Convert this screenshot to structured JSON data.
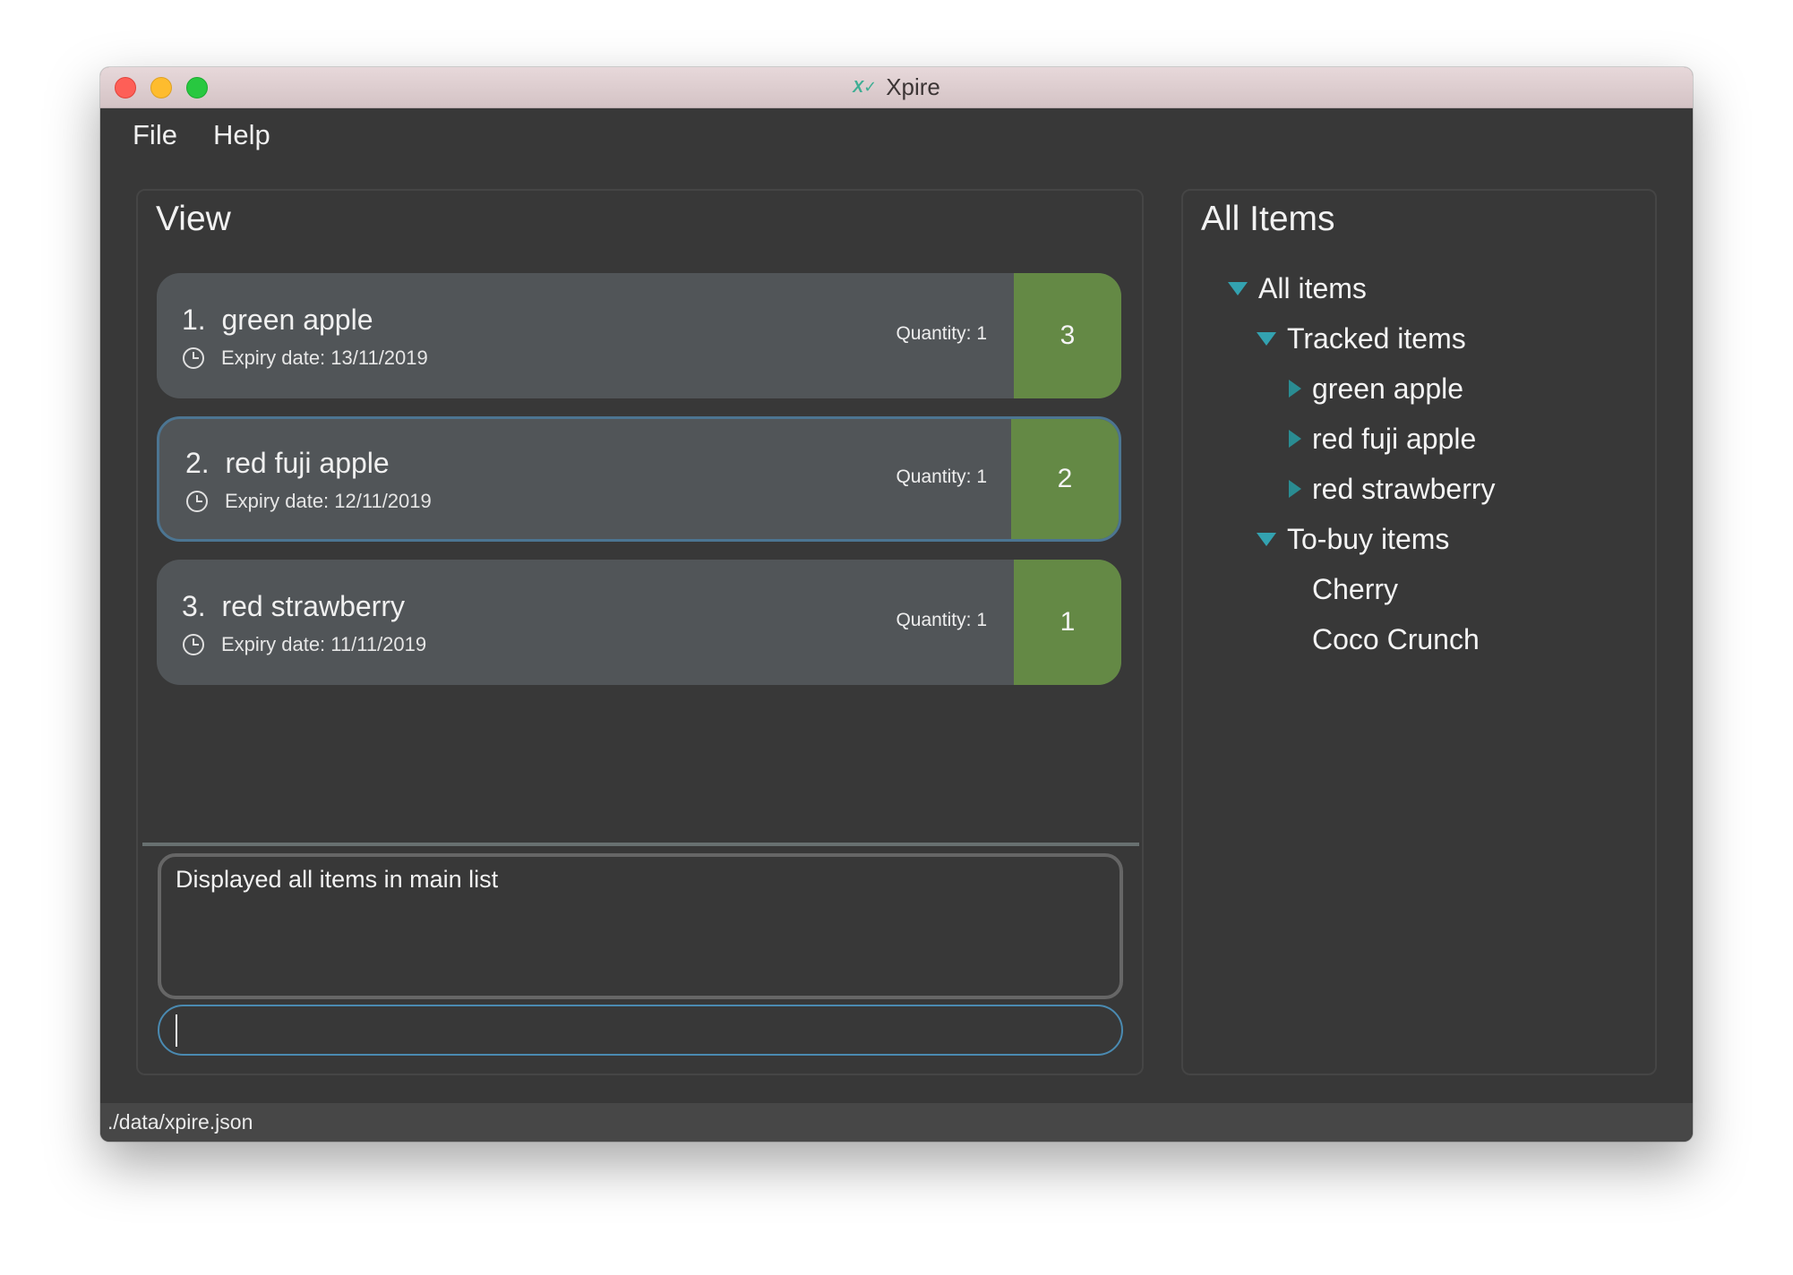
{
  "window": {
    "title": "Xpire",
    "app_icon": "xpire-logo-icon"
  },
  "menu": {
    "items": [
      {
        "label": "File"
      },
      {
        "label": "Help"
      }
    ]
  },
  "view_panel": {
    "title": "View",
    "cards": [
      {
        "index": "1.",
        "name": "green apple",
        "expiry_label": "Expiry date: 13/11/2019",
        "quantity": "Quantity: 1",
        "days_left": "3",
        "selected": false
      },
      {
        "index": "2.",
        "name": "red fuji apple",
        "expiry_label": "Expiry date: 12/11/2019",
        "quantity": "Quantity: 1",
        "days_left": "2",
        "selected": true
      },
      {
        "index": "3.",
        "name": "red strawberry",
        "expiry_label": "Expiry date: 11/11/2019",
        "quantity": "Quantity: 1",
        "days_left": "1",
        "selected": false
      }
    ],
    "result_text": "Displayed all items in main list",
    "command_value": "",
    "command_placeholder": ""
  },
  "all_items_panel": {
    "title": "All Items",
    "tree": [
      {
        "label": "All items",
        "level": 0,
        "toggle": "expanded"
      },
      {
        "label": "Tracked items",
        "level": 1,
        "toggle": "expanded"
      },
      {
        "label": "green apple",
        "level": 2,
        "toggle": "collapsed"
      },
      {
        "label": "red fuji apple",
        "level": 2,
        "toggle": "collapsed"
      },
      {
        "label": "red strawberry",
        "level": 2,
        "toggle": "collapsed"
      },
      {
        "label": "To-buy items",
        "level": 1,
        "toggle": "expanded"
      },
      {
        "label": "Cherry",
        "level": 2,
        "toggle": "none"
      },
      {
        "label": "Coco Crunch",
        "level": 2,
        "toggle": "none"
      }
    ]
  },
  "status_bar": {
    "path": "./data/xpire.json"
  },
  "colors": {
    "background": "#383838",
    "card": "#515558",
    "days_badge": "#648945",
    "selected_border": "#4c7592",
    "command_border": "#4a8ab1",
    "tree_toggle": "#33a2b0"
  }
}
